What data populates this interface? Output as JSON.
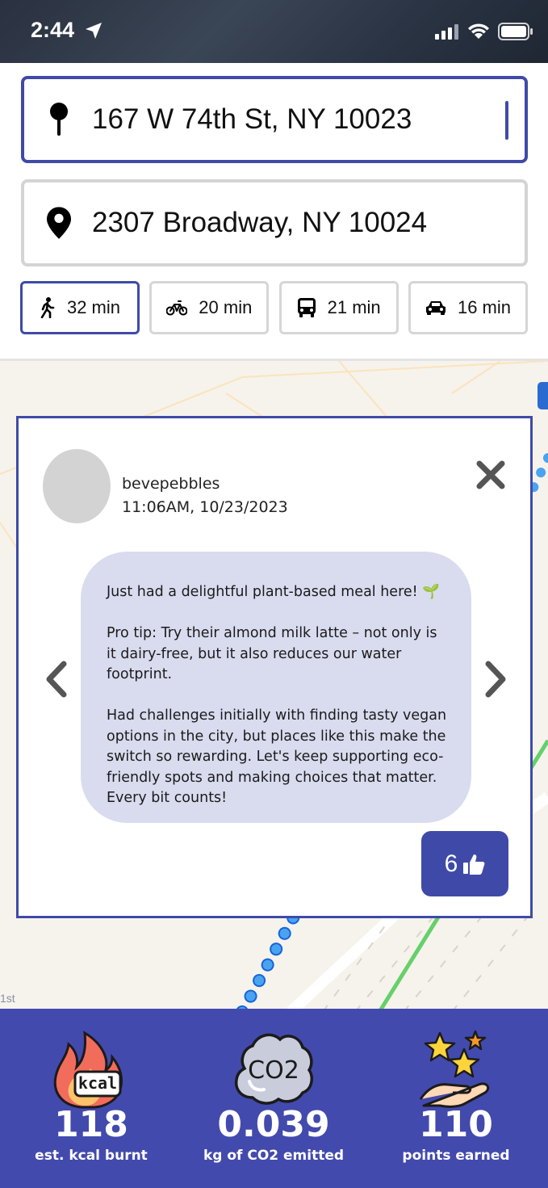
{
  "status_bar": {
    "time": "2:44"
  },
  "route": {
    "origin": "167 W 74th St, NY 10023",
    "destination": "2307 Broadway, NY 10024"
  },
  "modes": [
    {
      "icon": "walk-icon",
      "label": "32 min",
      "active": true
    },
    {
      "icon": "bike-icon",
      "label": "20 min",
      "active": false
    },
    {
      "icon": "bus-icon",
      "label": "21 min",
      "active": false
    },
    {
      "icon": "car-icon",
      "label": "16 min",
      "active": false
    }
  ],
  "map": {
    "label": "1st"
  },
  "post": {
    "username": "bevepebbles",
    "timestamp": "11:06AM, 10/23/2023",
    "paragraphs": [
      "Just had a delightful plant-based meal here! 🌱",
      "Pro tip: Try their almond milk latte – not only is it dairy-free, but it also reduces our water footprint.",
      "Had challenges initially with finding tasty vegan options in the city, but places like this make the switch so rewarding. Let's keep supporting eco-friendly spots and making choices that matter. Every bit counts!"
    ],
    "likes": "6"
  },
  "stats": [
    {
      "icon": "kcal-flame-icon",
      "icon_text": "kcal",
      "value": "118",
      "label": "est. kcal burnt"
    },
    {
      "icon": "co2-cloud-icon",
      "icon_text": "CO2",
      "value": "0.039",
      "label": "kg of CO2 emitted"
    },
    {
      "icon": "stars-hand-icon",
      "value": "110",
      "label": "points earned"
    }
  ],
  "colors": {
    "accent": "#3f4aa8",
    "stats_bar": "#434aad",
    "bubble": "#d9dcef"
  }
}
